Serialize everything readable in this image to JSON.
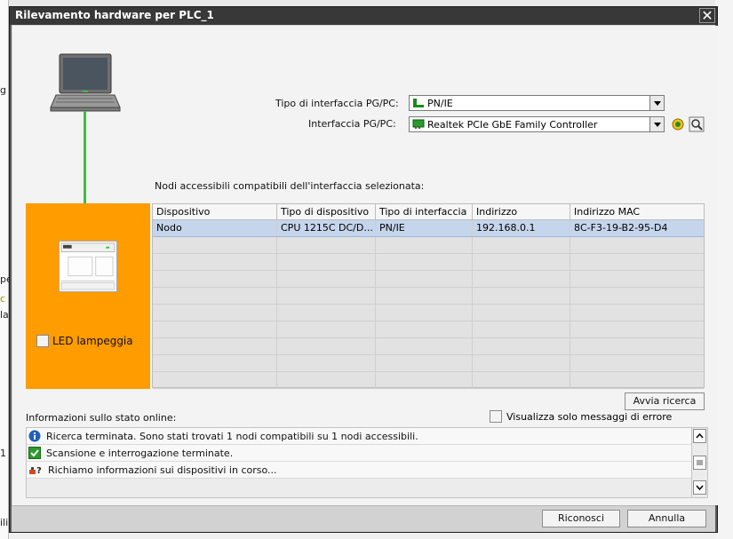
{
  "window": {
    "title": "Rilevamento hardware per PLC_1",
    "close_glyph": "✕"
  },
  "background": {
    "left_fragments": [
      "g",
      "pe",
      "c",
      "la",
      "1",
      "ili"
    ]
  },
  "interface_type": {
    "label": "Tipo di interfaccia PG/PC:",
    "value": "PN/IE",
    "icon": "network-port-icon"
  },
  "interface": {
    "label": "Interfaccia PG/PC:",
    "value": "Realtek PCIe GbE Family Controller",
    "icon": "network-card-icon",
    "extra_buttons": [
      "connection-status-icon",
      "properties-icon"
    ]
  },
  "nodes": {
    "label": "Nodi accessibili compatibili dell'interfaccia selezionata:",
    "columns": [
      "Dispositivo",
      "Tipo di dispositivo",
      "Tipo di interfaccia",
      "Indirizzo",
      "Indirizzo MAC"
    ],
    "rows": [
      [
        "Nodo",
        "CPU 1215C DC/D...",
        "PN/IE",
        "192.168.0.1",
        "8C-F3-19-B2-95-D4"
      ]
    ],
    "empty_rows": 9
  },
  "led": {
    "label": "LED lampeggia",
    "checked": false
  },
  "search_button": "Avvia ricerca",
  "status": {
    "label": "Informazioni sullo stato online:",
    "filter_label": "Visualizza solo messaggi di errore",
    "filter_checked": false,
    "messages": [
      {
        "icon": "info-icon",
        "text": "Ricerca terminata. Sono stati trovati 1 nodi compatibili su 1 nodi accessibili."
      },
      {
        "icon": "check-icon",
        "text": "Scansione e interrogazione terminate."
      },
      {
        "icon": "query-device-icon",
        "text": "Richiamo informazioni sui dispositivi in corso..."
      }
    ]
  },
  "footer": {
    "confirm": "Riconosci",
    "cancel": "Annulla"
  },
  "colors": {
    "accent_orange": "#FF9C00",
    "connection_green": "#3CBF3C",
    "selection": "#C5D5EC",
    "title_bar": "#383838"
  }
}
